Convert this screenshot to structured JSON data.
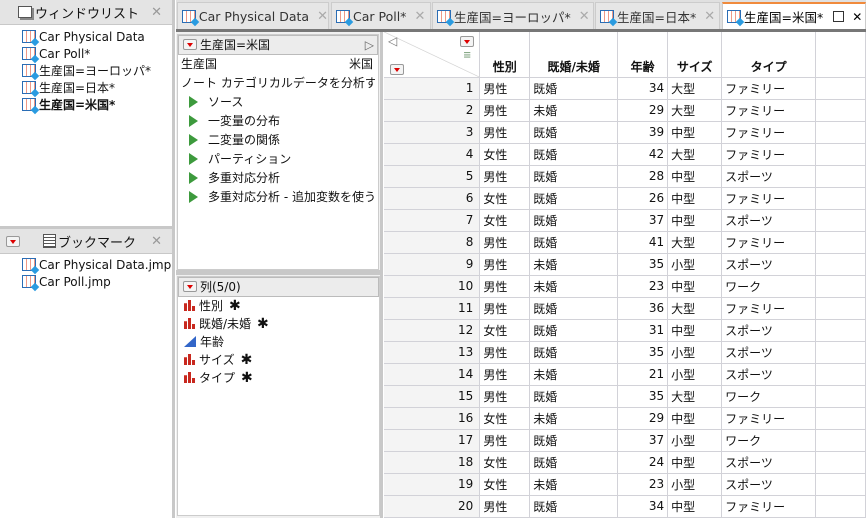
{
  "window_list": {
    "title": "ウィンドウリスト",
    "items": [
      "Car Physical Data",
      "Car Poll*",
      "生産国=ヨーロッパ*",
      "生産国=日本*",
      "生産国=米国*"
    ],
    "active_index": 4
  },
  "bookmarks": {
    "title": "ブックマーク",
    "items": [
      "Car Physical Data.jmp",
      "Car Poll.jmp"
    ]
  },
  "tabs": [
    {
      "label": "Car Physical Data"
    },
    {
      "label": "Car Poll*"
    },
    {
      "label": "生産国=ヨーロッパ*"
    },
    {
      "label": "生産国=日本*"
    },
    {
      "label": "生産国=米国*",
      "active": true
    }
  ],
  "table_panel": {
    "title": "生産国=米国",
    "prop_name": "生産国",
    "prop_value": "米国",
    "note": "ノート カテゴリカルデータを分析す",
    "scripts": [
      "ソース",
      "一変量の分布",
      "二変量の関係",
      "パーティション",
      "多重対応分析",
      "多重対応分析 - 追加変数を使う"
    ]
  },
  "columns_panel": {
    "title": "列(5/0)",
    "items": [
      {
        "name": "性別",
        "type": "nominal",
        "locked": true
      },
      {
        "name": "既婚/未婚",
        "type": "nominal",
        "locked": true
      },
      {
        "name": "年齢",
        "type": "continuous",
        "locked": false
      },
      {
        "name": "サイズ",
        "type": "nominal",
        "locked": true
      },
      {
        "name": "タイプ",
        "type": "nominal",
        "locked": true
      }
    ]
  },
  "grid": {
    "headers": [
      "性別",
      "既婚/未婚",
      "年齢",
      "サイズ",
      "タイプ"
    ],
    "rows": [
      [
        "1",
        "男性",
        "既婚",
        "34",
        "大型",
        "ファミリー"
      ],
      [
        "2",
        "男性",
        "未婚",
        "29",
        "大型",
        "ファミリー"
      ],
      [
        "3",
        "男性",
        "既婚",
        "39",
        "中型",
        "ファミリー"
      ],
      [
        "4",
        "女性",
        "既婚",
        "42",
        "大型",
        "ファミリー"
      ],
      [
        "5",
        "男性",
        "既婚",
        "28",
        "中型",
        "スポーツ"
      ],
      [
        "6",
        "女性",
        "既婚",
        "26",
        "中型",
        "ファミリー"
      ],
      [
        "7",
        "女性",
        "既婚",
        "37",
        "中型",
        "スポーツ"
      ],
      [
        "8",
        "男性",
        "既婚",
        "41",
        "大型",
        "ファミリー"
      ],
      [
        "9",
        "男性",
        "未婚",
        "35",
        "小型",
        "スポーツ"
      ],
      [
        "10",
        "男性",
        "未婚",
        "23",
        "中型",
        "ワーク"
      ],
      [
        "11",
        "男性",
        "既婚",
        "36",
        "大型",
        "ファミリー"
      ],
      [
        "12",
        "女性",
        "既婚",
        "31",
        "中型",
        "スポーツ"
      ],
      [
        "13",
        "男性",
        "既婚",
        "35",
        "小型",
        "スポーツ"
      ],
      [
        "14",
        "男性",
        "未婚",
        "21",
        "小型",
        "スポーツ"
      ],
      [
        "15",
        "男性",
        "既婚",
        "35",
        "大型",
        "ワーク"
      ],
      [
        "16",
        "女性",
        "未婚",
        "29",
        "中型",
        "ファミリー"
      ],
      [
        "17",
        "男性",
        "既婚",
        "37",
        "小型",
        "ワーク"
      ],
      [
        "18",
        "女性",
        "既婚",
        "24",
        "中型",
        "スポーツ"
      ],
      [
        "19",
        "女性",
        "未婚",
        "23",
        "小型",
        "スポーツ"
      ],
      [
        "20",
        "男性",
        "既婚",
        "34",
        "中型",
        "ファミリー"
      ]
    ]
  },
  "colors": {
    "active_tab_accent": "#f08a3c",
    "nominal_icon": "#c8281e",
    "continuous_icon": "#3266c8",
    "script_triangle": "#3d9a3d"
  }
}
